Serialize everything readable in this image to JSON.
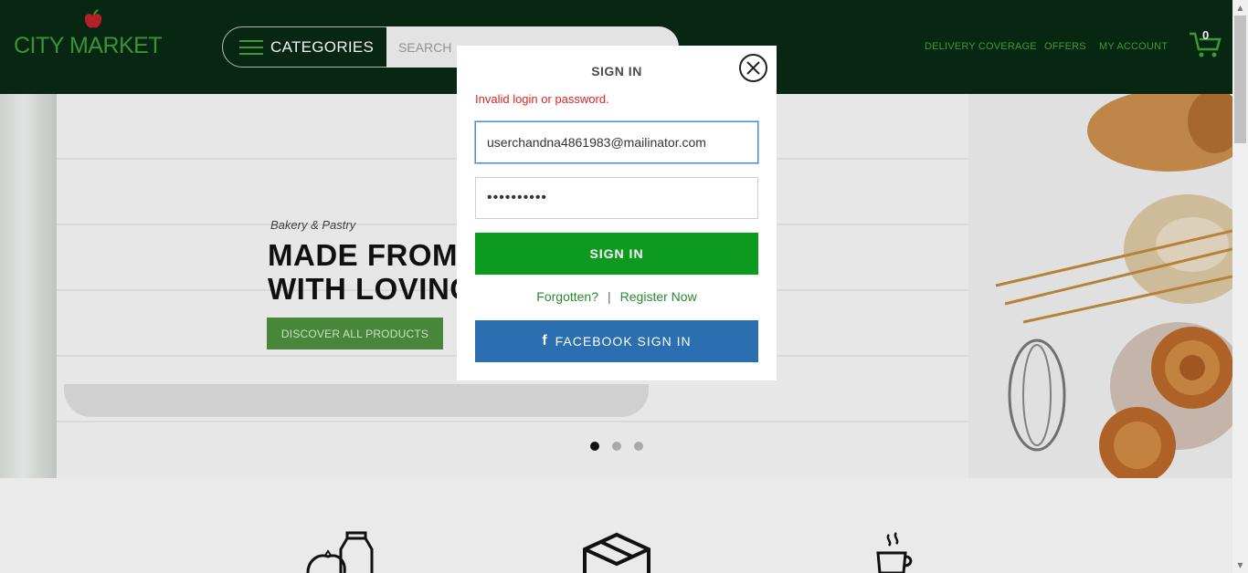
{
  "header": {
    "logo_text": "CITY MARKET",
    "categories_label": "CATEGORIES",
    "search_placeholder": "SEARCH",
    "nav": {
      "delivery": "DELIVERY COVERAGE",
      "offers": "OFFERS",
      "account": "MY ACCOUNT"
    },
    "cart_count": "0"
  },
  "hero": {
    "subtitle": "Bakery & Pastry",
    "headline_line1": "MADE FROM",
    "headline_line2": "WITH LOVING",
    "cta": "DISCOVER ALL PRODUCTS",
    "slides": 3,
    "active_slide": 1
  },
  "modal": {
    "title": "SIGN IN",
    "error": "Invalid login or password.",
    "email_value": "userchandna4861983@mailinator.com",
    "password_value": "••••••••••",
    "submit_label": "SIGN IN",
    "forgot_label": "Forgotten?",
    "separator": "|",
    "register_label": "Register Now",
    "facebook_label": "FACEBOOK SIGN IN",
    "facebook_icon": "f"
  },
  "icons": {
    "close": "close-icon",
    "menu": "hamburger-icon",
    "search": "search-icon",
    "cart": "cart-icon",
    "facebook": "facebook-icon"
  },
  "colors": {
    "header_bg": "#092a13",
    "brand_green": "#3fa33b",
    "signin_green": "#0c9b1f",
    "facebook_blue": "#2c6fb0",
    "error_red": "#e02424"
  }
}
